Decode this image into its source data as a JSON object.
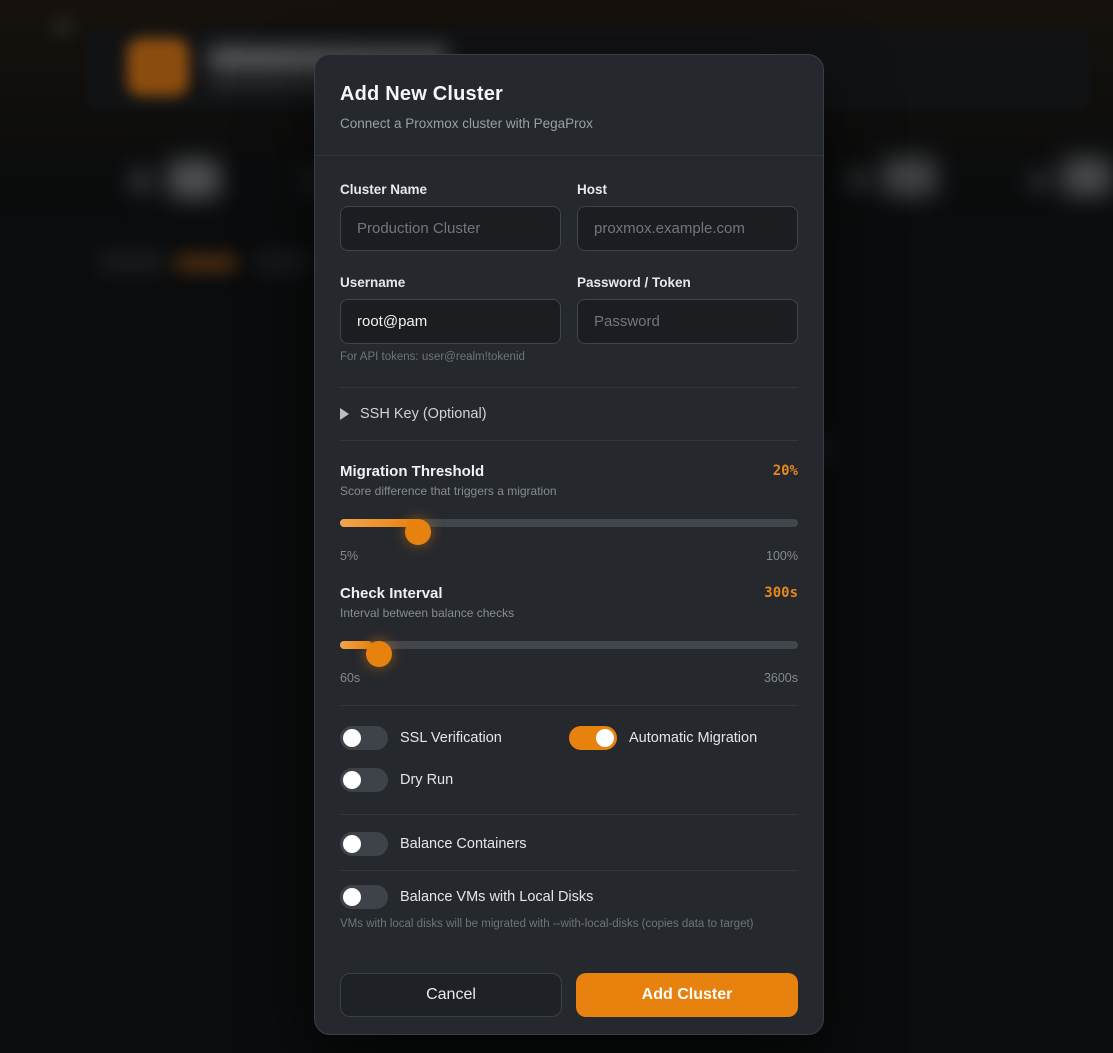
{
  "modal": {
    "title": "Add New Cluster",
    "subtitle": "Connect a Proxmox cluster with PegaProx",
    "fields": {
      "cluster_name": {
        "label": "Cluster Name",
        "placeholder": "Production Cluster",
        "value": ""
      },
      "host": {
        "label": "Host",
        "placeholder": "proxmox.example.com",
        "value": ""
      },
      "username": {
        "label": "Username",
        "value": "root@pam",
        "helper": "For API tokens: user@realm!tokenid"
      },
      "password": {
        "label": "Password / Token",
        "placeholder": "Password",
        "value": ""
      }
    },
    "ssh_section": {
      "label": "SSH Key (Optional)",
      "collapsed": true,
      "icon": "triangle-right-icon"
    },
    "sliders": [
      {
        "label": "Migration Threshold",
        "description": "Score difference that triggers a migration",
        "value_display": "20%",
        "min_label": "5%",
        "max_label": "100%",
        "fill_pct": "17.2%",
        "thumb_pct": "17%"
      },
      {
        "label": "Check Interval",
        "description": "Interval between balance checks",
        "value_display": "300s",
        "min_label": "60s",
        "max_label": "3600s",
        "fill_pct": "7%",
        "thumb_pct": "8.5%"
      }
    ],
    "toggles": [
      {
        "label": "SSL Verification",
        "on": false
      },
      {
        "label": "Automatic Migration",
        "on": true
      },
      {
        "label": "Dry Run",
        "on": false
      }
    ],
    "balance_toggles": [
      {
        "label": "Balance Containers",
        "on": false
      },
      {
        "label": "Balance VMs with Local Disks",
        "on": false,
        "helper": "VMs with local disks will be migrated with --with-local-disks (copies data to target)"
      }
    ],
    "buttons": {
      "cancel": "Cancel",
      "submit": "Add Cluster"
    }
  },
  "colors": {
    "accent_orange": "#e8820f",
    "value_orange": "#e8871c",
    "modal_bg": "#25282d",
    "input_bg": "#1b1d21",
    "toggle_off": "#3e4249",
    "logo_orange": "#cf7013"
  }
}
